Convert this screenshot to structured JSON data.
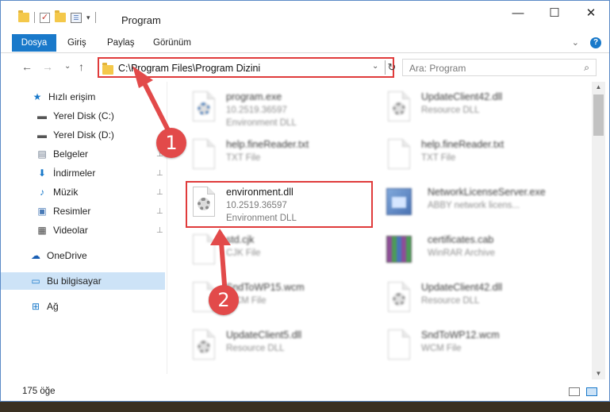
{
  "window": {
    "title": "Program",
    "minimize_glyph": "—",
    "maximize_glyph": "☐",
    "close_glyph": "✕"
  },
  "ribbon": {
    "tabs": [
      "Dosya",
      "Giriş",
      "Paylaş",
      "Görünüm"
    ],
    "expand_glyph": "⌄",
    "help_glyph": "?"
  },
  "navigation": {
    "back_glyph": "←",
    "forward_glyph": "→",
    "recent_glyph": "⌄",
    "up_glyph": "↑",
    "address": "C:\\Program Files\\Program Dizini",
    "dropdown_glyph": "⌄",
    "refresh_glyph": "↻",
    "search_placeholder": "Ara: Program",
    "search_glyph": "⌕"
  },
  "sidebar": {
    "items": [
      {
        "label": "Hızlı erişim",
        "icon": "star-icon"
      },
      {
        "label": "Yerel Disk (C:)",
        "icon": "drive-icon"
      },
      {
        "label": "Yerel Disk (D:)",
        "icon": "drive-icon"
      },
      {
        "label": "Belgeler",
        "icon": "documents-icon"
      },
      {
        "label": "İndirmeler",
        "icon": "download-icon"
      },
      {
        "label": "Müzik",
        "icon": "music-icon"
      },
      {
        "label": "Resimler",
        "icon": "pictures-icon"
      },
      {
        "label": "Videolar",
        "icon": "video-icon"
      },
      {
        "label": "OneDrive",
        "icon": "cloud-icon"
      },
      {
        "label": "Bu bilgisayar",
        "icon": "computer-icon"
      },
      {
        "label": "Ağ",
        "icon": "network-icon"
      }
    ],
    "pin_glyph": "📌"
  },
  "files": [
    {
      "name": "program.exe",
      "line2": "10.2519.36597",
      "line3": "Environment DLL"
    },
    {
      "name": "UpdateClient42.dll",
      "line2": "Resource DLL",
      "line3": ""
    },
    {
      "name": "help.fineReader.txt",
      "line2": "TXT File",
      "line3": ""
    },
    {
      "name": "help.fineReader.txt",
      "line2": "TXT File",
      "line3": ""
    },
    {
      "name": "environment.dll",
      "line2": "10.2519.36597",
      "line3": "Environment DLL"
    },
    {
      "name": "NetworkLicenseServer.exe",
      "line2": "ABBY network licens...",
      "line3": ""
    },
    {
      "name": "std.cjk",
      "line2": "CJK File",
      "line3": ""
    },
    {
      "name": "certificates.cab",
      "line2": "WinRAR Archive",
      "line3": ""
    },
    {
      "name": "SndToWP15.wcm",
      "line2": "WCM File",
      "line3": ""
    },
    {
      "name": "UpdateClient42.dll",
      "line2": "Resource DLL",
      "line3": ""
    },
    {
      "name": "UpdateClient5.dll",
      "line2": "Resource DLL",
      "line3": ""
    },
    {
      "name": "SndToWP12.wcm",
      "line2": "WCM File",
      "line3": ""
    }
  ],
  "status": {
    "item_count": "175 öğe"
  },
  "callouts": {
    "one": "1",
    "two": "2"
  },
  "colors": {
    "accent": "#1979ca",
    "highlight": "#e03b3b",
    "callout": "#e24a4a"
  }
}
